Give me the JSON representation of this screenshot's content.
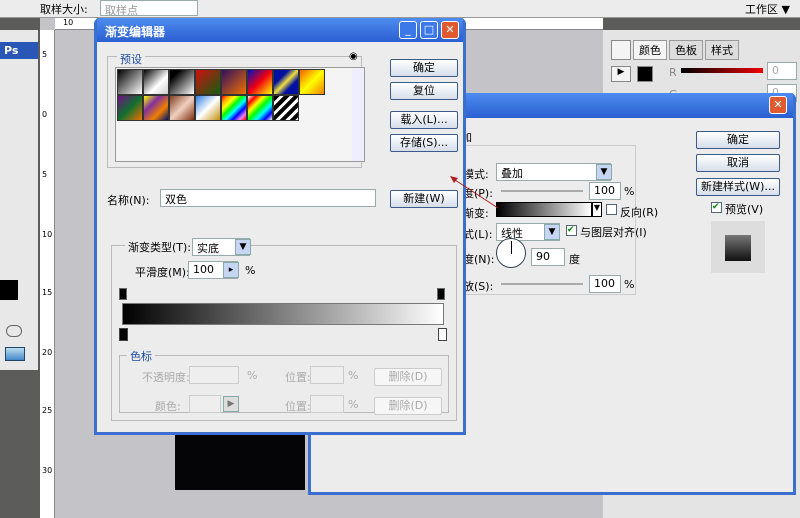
{
  "options_bar": {
    "sample_size_label": "取样大小:",
    "sample_size_value": "取样点",
    "workspace_label": "工作区 ▼"
  },
  "ruler": {
    "h": [
      "10"
    ],
    "v": [
      "5",
      "0",
      "5",
      "10",
      "15",
      "20",
      "25",
      "30"
    ]
  },
  "toolbox": {
    "logo": "Ps"
  },
  "right_panel": {
    "tabs": [
      "颜色",
      "色板",
      "样式"
    ],
    "channels": [
      {
        "label": "R",
        "value": "0"
      },
      {
        "label": "G",
        "value": "0"
      }
    ]
  },
  "gradient_editor": {
    "title": "渐变编辑器",
    "presets_label": "预设",
    "ok": "确定",
    "reset": "复位",
    "load": "载入(L)...",
    "save": "存储(S)...",
    "name_label": "名称(N):",
    "name_value": "双色",
    "new": "新建(W)",
    "type_label": "渐变类型(T):",
    "type_value": "实底",
    "smooth_label": "平滑度(M):",
    "smooth_value": "100",
    "pct": "%",
    "stops_label": "色标",
    "opacity_label": "不透明度:",
    "color_label": "颜色:",
    "location_label": "位置:",
    "delete": "删除(D)",
    "presets": [
      "linear-gradient(135deg,#000,#fff)",
      "linear-gradient(135deg,#000,#fff 60%,#ccc)",
      "linear-gradient(135deg,#000 20%,#fff)",
      "linear-gradient(135deg,#d01010,#106010)",
      "linear-gradient(135deg,#301060,#f07000)",
      "linear-gradient(135deg,#0010c0,#f00010,#ff0)",
      "linear-gradient(135deg,#0010a0 30%,#f0e040 50%,#0010a0 70%)",
      "linear-gradient(135deg,#f06000,#ff0,#f08000)",
      "linear-gradient(135deg,#701080,#107030,#f07000)",
      "linear-gradient(135deg,#ff0,#8030a0,#f08000,#001070)",
      "linear-gradient(135deg,#804020,#f0d0c0,#803010)",
      "linear-gradient(135deg,#3080e0,#fff,#c09010)",
      "linear-gradient(135deg,red,orange,yellow,lime,cyan,blue,violet,red)",
      "linear-gradient(135deg,#fff,red,yellow,lime,cyan,blue,#fff)",
      "repeating-linear-gradient(135deg,#000 0 4px,#fff 4px 7px)"
    ]
  },
  "layer_style": {
    "ok": "确定",
    "cancel": "取消",
    "new_style": "新建样式(W)...",
    "preview": "预览(V)",
    "group_suffix": "加",
    "blend_label": "模式:",
    "blend_value": "叠加",
    "opacity_label": "度(P):",
    "opacity_value": "100",
    "gradient_label": "渐变:",
    "reverse": "反向(R)",
    "style_label": "式(L):",
    "style_value": "线性",
    "align": "与图层对齐(I)",
    "angle_label": "度(N):",
    "angle_value": "90",
    "angle_unit": "度",
    "scale_label": "放(S):",
    "scale_value": "100",
    "pct": "%"
  }
}
